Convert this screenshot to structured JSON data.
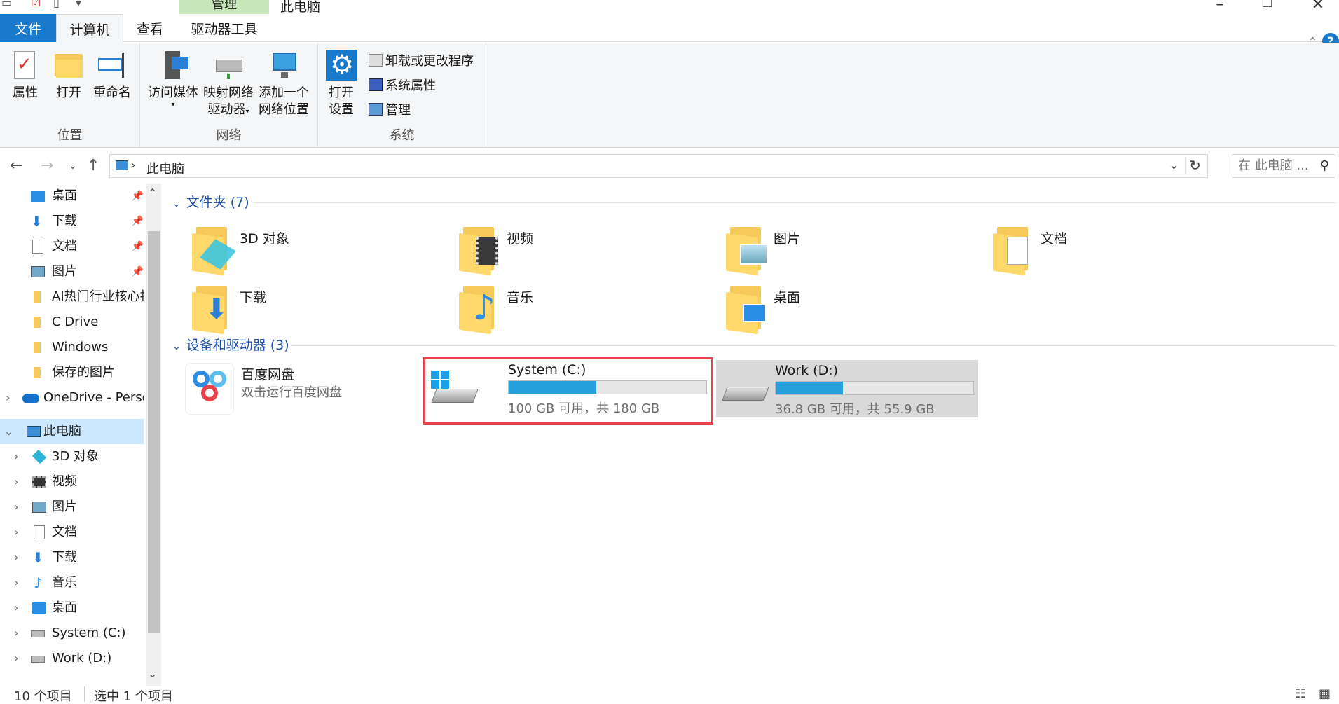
{
  "window": {
    "title": "此电脑",
    "manage_tag": "管理"
  },
  "tabs": [
    "文件",
    "计算机",
    "查看",
    "驱动器工具"
  ],
  "ribbon": {
    "location": {
      "label": "位置",
      "properties": "属性",
      "open": "打开",
      "rename": "重命名"
    },
    "network": {
      "label": "网络",
      "media": "访问媒体",
      "map_drive_1": "映射网络",
      "map_drive_2": "驱动器",
      "add_loc_1": "添加一个",
      "add_loc_2": "网络位置"
    },
    "system": {
      "label": "系统",
      "open_settings_1": "打开",
      "open_settings_2": "设置",
      "uninstall": "卸载或更改程序",
      "sys_props": "系统属性",
      "manage": "管理"
    }
  },
  "address": {
    "path": "此电脑",
    "search_placeholder": "在 此电脑 ..."
  },
  "nav": {
    "quick": [
      {
        "label": "桌面",
        "icon": "desktop-icon",
        "pinned": true
      },
      {
        "label": "下载",
        "icon": "download-icon",
        "pinned": true
      },
      {
        "label": "文档",
        "icon": "document-icon",
        "pinned": true
      },
      {
        "label": "图片",
        "icon": "pictures-icon",
        "pinned": true
      },
      {
        "label": "AI热门行业核心打",
        "icon": "folder-icon",
        "pinned": false
      },
      {
        "label": "C Drive",
        "icon": "folder-icon",
        "pinned": false
      },
      {
        "label": "Windows",
        "icon": "folder-icon",
        "pinned": false
      },
      {
        "label": "保存的图片",
        "icon": "folder-icon",
        "pinned": false
      }
    ],
    "onedrive": "OneDrive - Perso",
    "this_pc": "此电脑",
    "pc_children": [
      {
        "label": "3D 对象",
        "icon": "3d-objects-icon"
      },
      {
        "label": "视频",
        "icon": "video-icon"
      },
      {
        "label": "图片",
        "icon": "pictures-icon"
      },
      {
        "label": "文档",
        "icon": "document-icon"
      },
      {
        "label": "下载",
        "icon": "download-icon"
      },
      {
        "label": "音乐",
        "icon": "music-icon"
      },
      {
        "label": "桌面",
        "icon": "desktop-icon"
      },
      {
        "label": "System (C:)",
        "icon": "system-drive-icon"
      },
      {
        "label": "Work (D:)",
        "icon": "drive-icon"
      }
    ]
  },
  "content": {
    "folders_header": "文件夹 (7)",
    "folders": [
      {
        "label": "3D 对象",
        "icon": "3d-objects-folder-icon"
      },
      {
        "label": "视频",
        "icon": "video-folder-icon"
      },
      {
        "label": "图片",
        "icon": "pictures-folder-icon"
      },
      {
        "label": "文档",
        "icon": "documents-folder-icon"
      },
      {
        "label": "下载",
        "icon": "downloads-folder-icon"
      },
      {
        "label": "音乐",
        "icon": "music-folder-icon"
      },
      {
        "label": "桌面",
        "icon": "desktop-folder-icon"
      }
    ],
    "devices_header": "设备和驱动器 (3)",
    "baidu": {
      "label": "百度网盘",
      "sub": "双击运行百度网盘"
    },
    "drives": [
      {
        "label": "System (C:)",
        "sub": "100 GB 可用，共 180 GB",
        "used_fraction": 0.444
      },
      {
        "label": "Work (D:)",
        "sub": "36.8 GB 可用，共 55.9 GB",
        "used_fraction": 0.342
      }
    ]
  },
  "status": {
    "count": "10 个项目",
    "selected": "选中 1 个项目"
  },
  "colors": {
    "accent": "#1979ca",
    "selection": "#cce8ff",
    "highlight_border": "#e8434b",
    "drive_bar": "#26a0da"
  }
}
